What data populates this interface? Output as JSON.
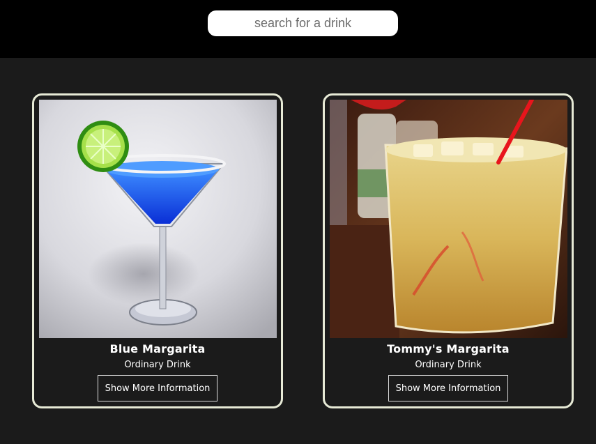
{
  "search": {
    "placeholder": "search for a drink",
    "value": ""
  },
  "drinks": [
    {
      "name": "Blue Margarita",
      "category": "Ordinary Drink",
      "button_label": "Show More Information",
      "image_icon": "blue-margarita-photo"
    },
    {
      "name": "Tommy's Margarita",
      "category": "Ordinary Drink",
      "button_label": "Show More Information",
      "image_icon": "tommys-margarita-photo"
    }
  ],
  "colors": {
    "header_bg": "#000000",
    "page_bg": "#1b1b1b",
    "card_border": "#e7ead6",
    "text": "#ffffff"
  }
}
